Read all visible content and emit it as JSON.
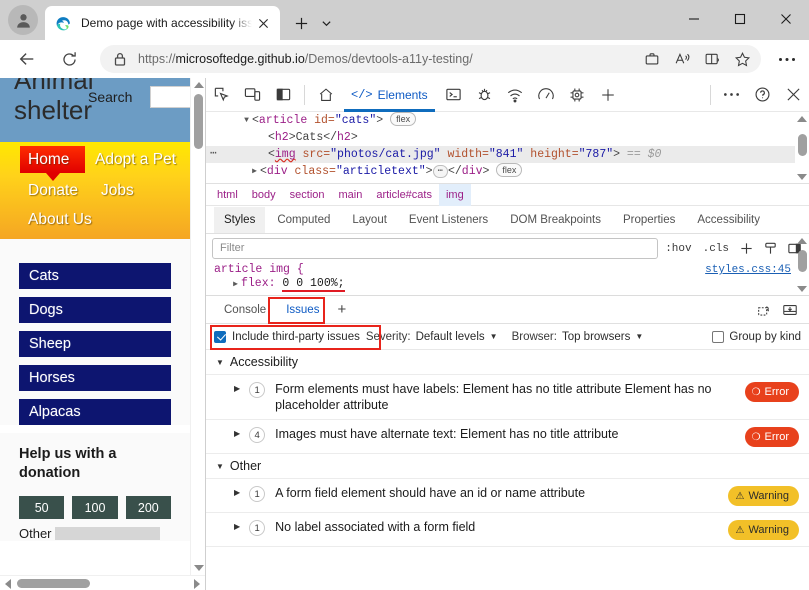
{
  "browser": {
    "tab": {
      "title": "Demo page with accessibility issues",
      "favicon": "edge-logo-icon",
      "close_label": "×"
    },
    "new_tab_label": "+",
    "tab_list_label": "⌄",
    "window_controls": {
      "minimize": "—",
      "maximize": "□",
      "close": "✕"
    },
    "nav": {
      "back": "←",
      "reload": "↻"
    },
    "url": {
      "lock": "lock-icon",
      "prefix": "https://",
      "domain": "microsoftedge.github.io",
      "path": "/Demos/devtools-a11y-testing/",
      "full": "https://microsoftedge.github.io/Demos/devtools-a11y-testing/"
    },
    "url_icons": [
      "collections-icon",
      "read-aloud-icon",
      "immersive-reader-icon",
      "favorite-star-icon"
    ],
    "more_label": "⋯"
  },
  "page": {
    "header": {
      "title": "Animal shelter",
      "search_label": "Search",
      "search_value": ""
    },
    "nav_links": [
      {
        "label": "Home",
        "active": true
      },
      {
        "label": "Adopt a Pet",
        "active": false
      },
      {
        "label": "Donate",
        "active": false
      },
      {
        "label": "Jobs",
        "active": false
      },
      {
        "label": "About Us",
        "active": false
      }
    ],
    "animals": [
      "Cats",
      "Dogs",
      "Sheep",
      "Horses",
      "Alpacas"
    ],
    "donation": {
      "title": "Help us with a donation",
      "amounts": [
        "50",
        "100",
        "200"
      ],
      "other_label": "Other",
      "other_value": ""
    },
    "colors": {
      "header_bg": "#6c9cc4",
      "nav_gradient_start": "#ffe800",
      "nav_gradient_end": "#f5a623",
      "nav_active_bg": "#e00000",
      "animal_bg": "#0d1570",
      "donate_btn_bg": "#39504b"
    }
  },
  "devtools": {
    "toolbar_icons": [
      "inspect-element-icon",
      "device-emulation-icon",
      "dock-side-icon"
    ],
    "home_icon": "home-icon",
    "panels": [
      {
        "label": "Elements",
        "icon": "code-brackets-icon",
        "active": true
      },
      {
        "label": "Console",
        "icon": "console-terminal-icon",
        "active": false
      },
      {
        "label": "Sources",
        "icon": "debugger-bug-icon",
        "active": false
      },
      {
        "label": "Network",
        "icon": "network-wifi-icon",
        "active": false
      },
      {
        "label": "Performance",
        "icon": "performance-gauge-icon",
        "active": false
      },
      {
        "label": "Application",
        "icon": "settings-chip-icon",
        "active": false
      }
    ],
    "add_panel_label": "+",
    "more_tools_label": "⋯",
    "help_label": "?",
    "close_label": "✕",
    "dom_tree": [
      {
        "indent": 4,
        "twisty": "▼",
        "segments": [
          {
            "t": "<",
            "c": "punct"
          },
          {
            "t": "article",
            "c": "tag"
          },
          {
            "t": " id=",
            "c": "attr"
          },
          {
            "t": "\"cats\"",
            "c": "val"
          },
          {
            "t": ">",
            "c": "punct"
          }
        ],
        "badge": "flex",
        "selected": false
      },
      {
        "indent": 6,
        "twisty": "",
        "segments": [
          {
            "t": "<",
            "c": "punct"
          },
          {
            "t": "h2",
            "c": "tag"
          },
          {
            "t": ">",
            "c": "punct"
          },
          {
            "t": "Cats",
            "c": "punct"
          },
          {
            "t": "</",
            "c": "punct"
          },
          {
            "t": "h2",
            "c": "tag"
          },
          {
            "t": ">",
            "c": "punct"
          }
        ],
        "badge": "",
        "selected": false
      },
      {
        "indent": 6,
        "twisty": "",
        "segments": [
          {
            "t": "<",
            "c": "punct"
          },
          {
            "t": "img",
            "c": "tag squig"
          },
          {
            "t": " src=",
            "c": "attr"
          },
          {
            "t": "\"photos/cat.jpg\"",
            "c": "val"
          },
          {
            "t": " width=",
            "c": "attr"
          },
          {
            "t": "\"841\"",
            "c": "val"
          },
          {
            "t": " height=",
            "c": "attr"
          },
          {
            "t": "\"787\"",
            "c": "val"
          },
          {
            "t": ">",
            "c": "punct"
          },
          {
            "t": " == $0",
            "c": "d0"
          }
        ],
        "badge": "",
        "selected": true,
        "row_dots": "•••"
      },
      {
        "indent": 5,
        "twisty": "▶",
        "segments": [
          {
            "t": "<",
            "c": "punct"
          },
          {
            "t": "div",
            "c": "tag"
          },
          {
            "t": " class=",
            "c": "attr"
          },
          {
            "t": "\"articletext\"",
            "c": "val"
          },
          {
            "t": ">",
            "c": "punct"
          },
          {
            "t": "…",
            "c": "dots"
          },
          {
            "t": "</",
            "c": "punct"
          },
          {
            "t": "div",
            "c": "tag"
          },
          {
            "t": ">",
            "c": "punct"
          }
        ],
        "badge": "flex",
        "selected": false
      }
    ],
    "breadcrumbs": [
      {
        "label": "html",
        "active": false
      },
      {
        "label": "body",
        "active": false
      },
      {
        "label": "section",
        "active": false
      },
      {
        "label": "main",
        "active": false
      },
      {
        "label": "article#cats",
        "active": false
      },
      {
        "label": "img",
        "active": true
      }
    ],
    "style_tabs": [
      {
        "label": "Styles",
        "active": true
      },
      {
        "label": "Computed",
        "active": false
      },
      {
        "label": "Layout",
        "active": false
      },
      {
        "label": "Event Listeners",
        "active": false
      },
      {
        "label": "DOM Breakpoints",
        "active": false
      },
      {
        "label": "Properties",
        "active": false
      },
      {
        "label": "Accessibility",
        "active": false
      }
    ],
    "styles": {
      "filter_placeholder": "Filter",
      "filter_value": "",
      "hov_label": ":hov",
      "cls_label": ".cls",
      "new_rule_label": "+",
      "icons": [
        "new-style-rule-icon",
        "element-state-icon",
        "copy-styles-icon"
      ],
      "rule_selector": "article img {",
      "rule_source": "styles.css:45",
      "declaration_prop": "flex:",
      "declaration_value": "0 0 100%;",
      "declaration_twisty": "▶"
    },
    "drawer": {
      "tabs": [
        {
          "label": "Console",
          "active": false
        },
        {
          "label": "Issues",
          "active": true
        }
      ],
      "add_tab_label": "+",
      "icons": [
        "clear-issues-icon",
        "dock-drawer-icon"
      ],
      "toolbar": {
        "include_third_party_label": "Include third-party issues",
        "include_third_party_checked": true,
        "severity_label": "Severity:",
        "severity_value": "Default levels",
        "browser_label": "Browser:",
        "browser_value": "Top browsers",
        "group_by_kind_label": "Group by kind",
        "group_by_kind_checked": false
      },
      "groups": [
        {
          "name": "Accessibility",
          "expanded": true,
          "issues": [
            {
              "count": "1",
              "text": "Form elements must have labels: Element has no title attribute Element has no placeholder attribute",
              "severity": "Error",
              "severity_kind": "error",
              "severity_icon": "⊗"
            },
            {
              "count": "4",
              "text": "Images must have alternate text: Element has no title attribute",
              "severity": "Error",
              "severity_kind": "error",
              "severity_icon": "⊗"
            }
          ]
        },
        {
          "name": "Other",
          "expanded": true,
          "issues": [
            {
              "count": "1",
              "text": "A form field element should have an id or name attribute",
              "severity": "Warning",
              "severity_kind": "warning",
              "severity_icon": "⚠"
            },
            {
              "count": "1",
              "text": "No label associated with a form field",
              "severity": "Warning",
              "severity_kind": "warning",
              "severity_icon": "⚠"
            }
          ]
        }
      ]
    },
    "annotation_color": "#e8241b"
  }
}
